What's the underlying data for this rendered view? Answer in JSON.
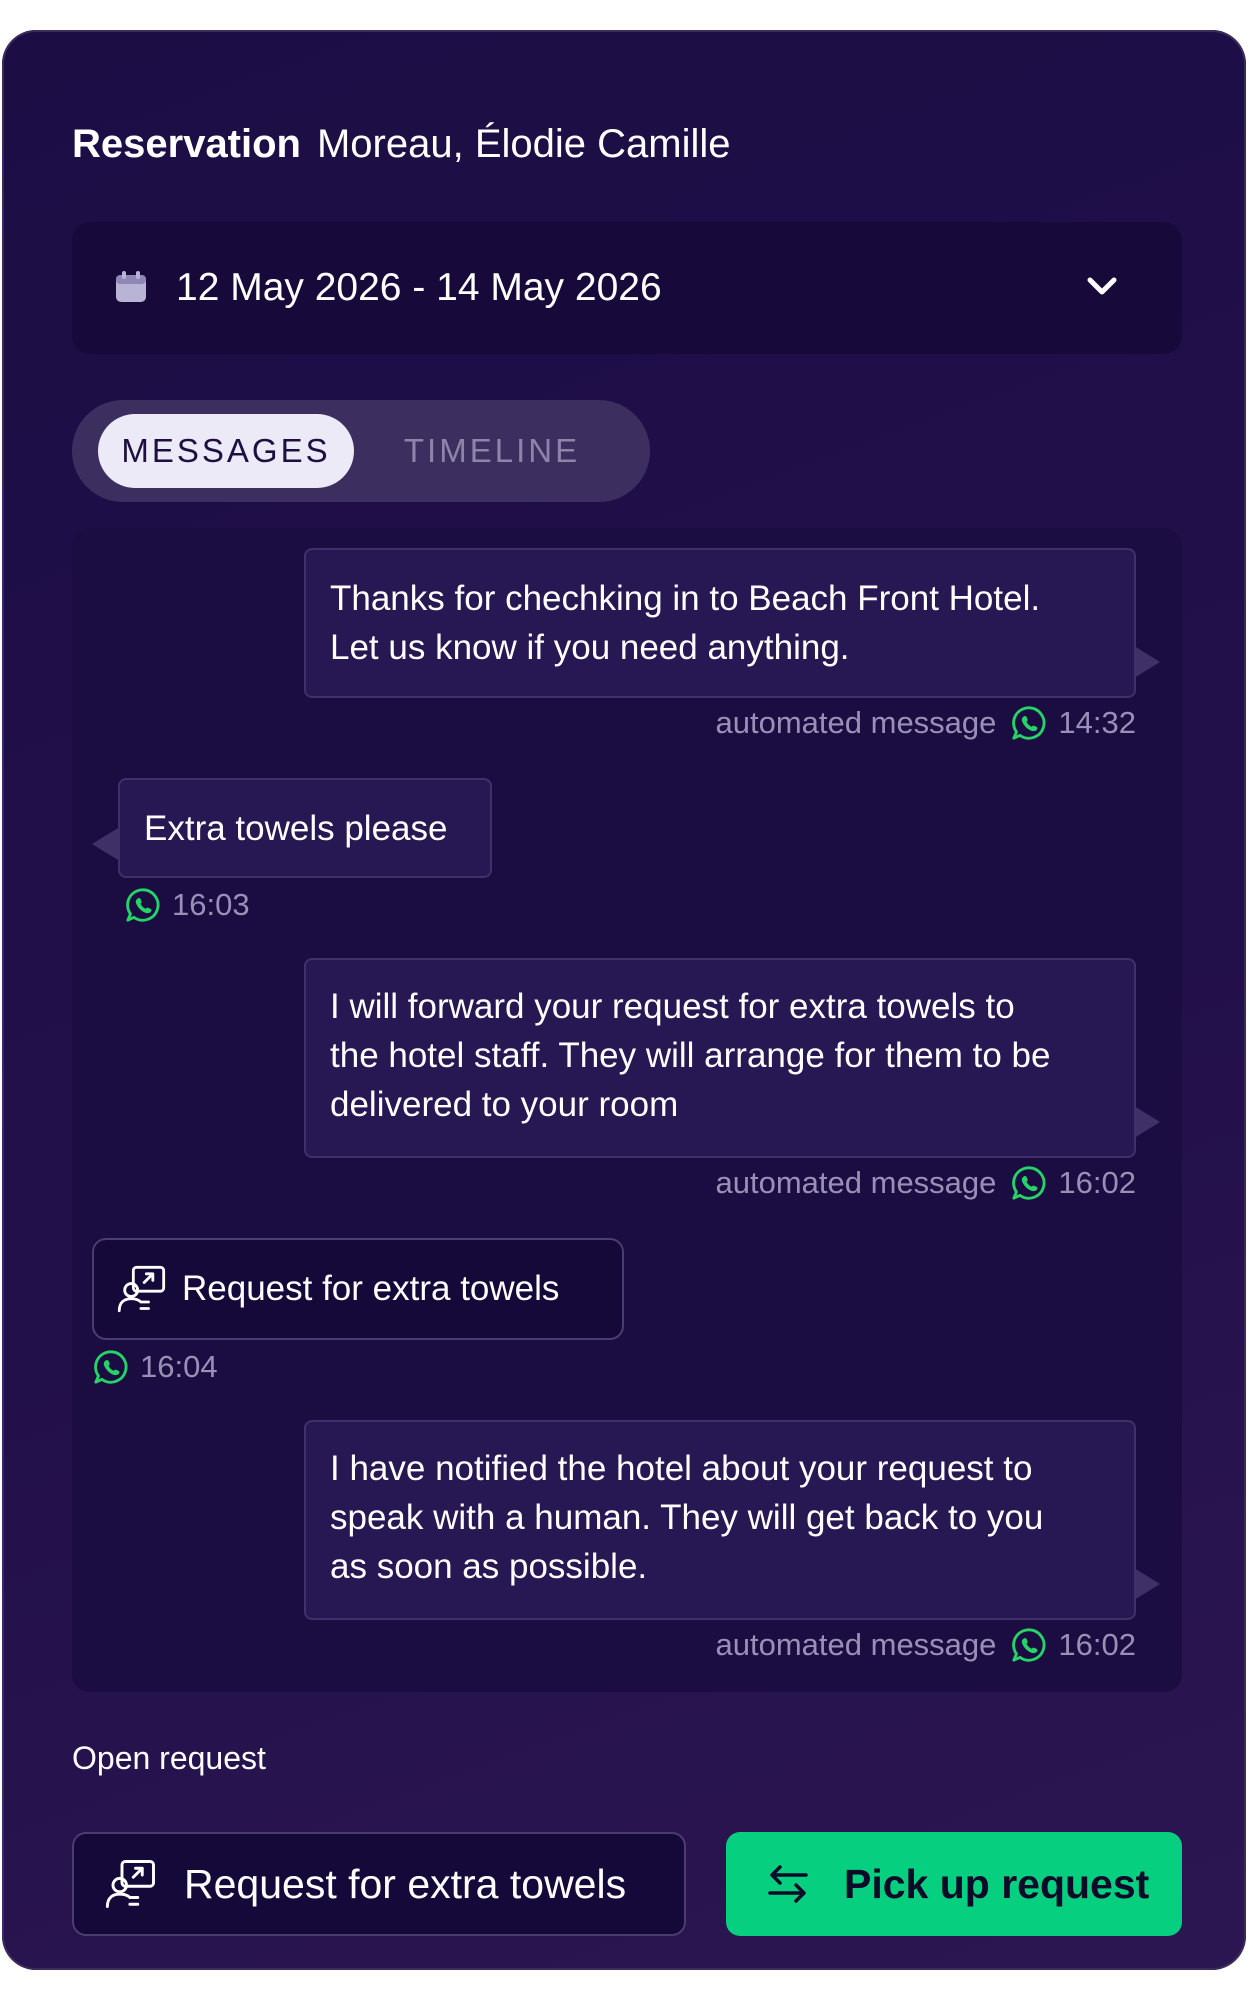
{
  "header": {
    "label": "Reservation",
    "guest_name": "Moreau, Élodie Camille"
  },
  "date_range": {
    "value": "12 May 2026 - 14 May 2026",
    "icon": "calendar-icon",
    "toggle_icon": "chevron-down-icon"
  },
  "tabs": [
    {
      "label": "MESSAGES",
      "active": true
    },
    {
      "label": "TIMELINE",
      "active": false
    }
  ],
  "messages": [
    {
      "lines": [
        "Thanks for chechking in  to Beach Front Hotel.",
        "Let us know if you need anything."
      ],
      "meta": "automated message",
      "time": "14:32"
    },
    {
      "lines": [
        "Extra towels please"
      ],
      "time": "16:03"
    },
    {
      "lines": [
        "I will forward your request for extra towels to",
        "the hotel staff. They will arrange for them to be",
        "delivered to your room"
      ],
      "meta": "automated message",
      "time": "16:02"
    },
    {
      "label": "Request for extra towels",
      "time": "16:04"
    },
    {
      "lines": [
        "I have notified the hotel about your request to",
        "speak with a human. They will get back to you",
        "as soon as possible."
      ],
      "meta": "automated message",
      "time": "16:02"
    }
  ],
  "open_request": {
    "heading": "Open request",
    "request_label": "Request for extra towels",
    "pickup_label": "Pick up request"
  },
  "colors": {
    "background": "#1c0d45",
    "accent_green": "#06d07f",
    "whatsapp_green": "#25d366"
  }
}
